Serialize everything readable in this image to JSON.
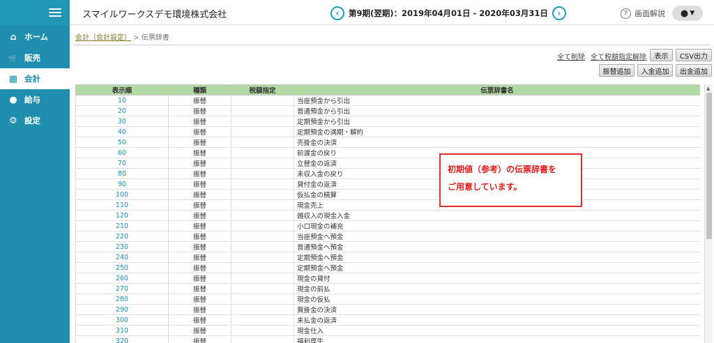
{
  "header": {
    "company": "スマイルワークスデモ環境株式会社",
    "period_text": "第9期(翌期)：2019年04月01日 - 2020年03月31日",
    "help_label": "画面解説",
    "user_caret": "▼"
  },
  "sidebar": {
    "items": [
      {
        "label": "ホーム",
        "icon": "home-icon",
        "glyph": "⌂"
      },
      {
        "label": "販売",
        "icon": "cart-icon",
        "glyph": "🛒"
      },
      {
        "label": "会計",
        "icon": "calculator-icon",
        "glyph": "▦"
      },
      {
        "label": "給与",
        "icon": "money-bag-icon",
        "glyph": "●"
      },
      {
        "label": "設定",
        "icon": "gear-icon",
        "glyph": "⚙"
      }
    ],
    "active_index": 2
  },
  "breadcrumb": {
    "link": "会計（会計設定）",
    "separator": " > ",
    "current": "伝票辞書"
  },
  "toolbar": {
    "delete_all": "全て削除",
    "clear_tax": "全て税額指定解除",
    "show": "表示",
    "csv": "CSV出力",
    "add_transfer": "振替追加",
    "add_deposit": "入金追加",
    "add_withdrawal": "出金追加"
  },
  "table": {
    "headers": [
      "表示順",
      "種類",
      "税額指定",
      "伝票辞書名"
    ],
    "rows": [
      {
        "order": "10",
        "kind": "振替",
        "tax": "",
        "name": "当座預金から引出"
      },
      {
        "order": "20",
        "kind": "振替",
        "tax": "",
        "name": "普通預金から引出"
      },
      {
        "order": "30",
        "kind": "振替",
        "tax": "",
        "name": "定期預金から引出"
      },
      {
        "order": "40",
        "kind": "振替",
        "tax": "",
        "name": "定期預金の満期・解約"
      },
      {
        "order": "50",
        "kind": "振替",
        "tax": "",
        "name": "売掛金の決済"
      },
      {
        "order": "60",
        "kind": "振替",
        "tax": "",
        "name": "前渡金の戻り"
      },
      {
        "order": "70",
        "kind": "振替",
        "tax": "",
        "name": "立替金の返済"
      },
      {
        "order": "80",
        "kind": "振替",
        "tax": "",
        "name": "未収入金の戻り"
      },
      {
        "order": "90",
        "kind": "振替",
        "tax": "",
        "name": "貸付金の返済"
      },
      {
        "order": "100",
        "kind": "振替",
        "tax": "",
        "name": "仮払金の精算"
      },
      {
        "order": "110",
        "kind": "振替",
        "tax": "",
        "name": "現金売上"
      },
      {
        "order": "120",
        "kind": "振替",
        "tax": "",
        "name": "雑収入の現金入金"
      },
      {
        "order": "210",
        "kind": "振替",
        "tax": "",
        "name": "小口現金の補充"
      },
      {
        "order": "220",
        "kind": "振替",
        "tax": "",
        "name": "当座預金へ預金"
      },
      {
        "order": "230",
        "kind": "振替",
        "tax": "",
        "name": "普通預金へ預金"
      },
      {
        "order": "240",
        "kind": "振替",
        "tax": "",
        "name": "定期預金へ預金"
      },
      {
        "order": "250",
        "kind": "振替",
        "tax": "",
        "name": "定期預金へ預金"
      },
      {
        "order": "260",
        "kind": "振替",
        "tax": "",
        "name": "現金の貸付"
      },
      {
        "order": "270",
        "kind": "振替",
        "tax": "",
        "name": "現金の前払"
      },
      {
        "order": "280",
        "kind": "振替",
        "tax": "",
        "name": "現金の仮払"
      },
      {
        "order": "290",
        "kind": "振替",
        "tax": "",
        "name": "買掛金の決済"
      },
      {
        "order": "300",
        "kind": "振替",
        "tax": "",
        "name": "未払金の返済"
      },
      {
        "order": "310",
        "kind": "振替",
        "tax": "",
        "name": "現金仕入"
      },
      {
        "order": "320",
        "kind": "振替",
        "tax": "",
        "name": "福利厚生"
      }
    ]
  },
  "callout": {
    "line1": "初期値（参考）の伝票辞書を",
    "line2": "ご用意しています。"
  },
  "colors": {
    "sidebar": "#1e8faf",
    "table_header": "#b3d9a4",
    "link_number": "#1a8fb8",
    "callout_border": "#e03030"
  }
}
